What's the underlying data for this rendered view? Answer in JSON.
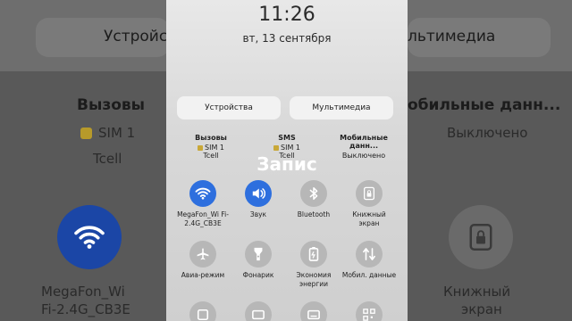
{
  "status": {
    "time": "11:26",
    "date": "вт, 13 сентября"
  },
  "tabs": {
    "devices": "Устройства",
    "multimedia": "Мультимедиа"
  },
  "sims": [
    {
      "title": "Вызовы",
      "sim": "SIM 1",
      "value": "Tcell"
    },
    {
      "title": "SMS",
      "sim": "SIM 1",
      "value": "Tcell"
    },
    {
      "title": "Мобильные данн...",
      "value": "Выключено"
    }
  ],
  "overlay_text": "Запис",
  "tiles": [
    {
      "label": "MegaFon_Wi Fi-2.4G_CB3E",
      "icon": "wifi-icon",
      "active": true
    },
    {
      "label": "Звук",
      "icon": "sound-icon",
      "active": true
    },
    {
      "label": "Bluetooth",
      "icon": "bluetooth-icon",
      "active": false
    },
    {
      "label": "Книжный экран",
      "icon": "lock-icon",
      "active": false
    },
    {
      "label": "Авиа-режим",
      "icon": "airplane-icon",
      "active": false
    },
    {
      "label": "Фонарик",
      "icon": "flashlight-icon",
      "active": false
    },
    {
      "label": "Экономия энергии",
      "icon": "battery-icon",
      "active": false
    },
    {
      "label": "Мобил. данные",
      "icon": "data-icon",
      "active": false
    }
  ],
  "background": {
    "tab_left": "Устройст",
    "tab_right": "льтимедиа",
    "calls_title": "Вызовы",
    "calls_sim": "SIM 1",
    "calls_operator": "Tcell",
    "data_title": "обильные данн...",
    "data_value": "Выключено",
    "wifi_label_1": "MegaFon_Wi",
    "wifi_label_2": "Fi-2.4G_CB3E",
    "book_label_1": "Книжный",
    "book_label_2": "экран"
  },
  "colors": {
    "accent": "#2e6fde",
    "inactive": "#b7b7b7"
  }
}
